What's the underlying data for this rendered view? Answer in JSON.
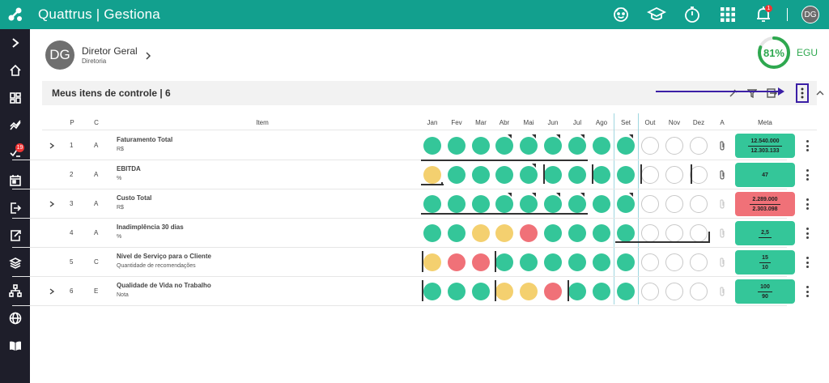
{
  "app": {
    "brand": "Quattrus",
    "product": "Gestiona",
    "title_sep": "|"
  },
  "topbar": {
    "icons": [
      "smile-icon",
      "graduation-cap-icon",
      "stopwatch-icon",
      "grid-icon",
      "bell-icon"
    ],
    "notification_count": "1",
    "avatar": "DG"
  },
  "sidebar": {
    "items": [
      {
        "icon": "chevron-right-icon"
      },
      {
        "icon": "home-icon"
      },
      {
        "icon": "dashboard-icon"
      },
      {
        "icon": "trend-icon"
      },
      {
        "icon": "check-list-icon",
        "badge": "19"
      },
      {
        "icon": "calendar-icon"
      },
      {
        "icon": "logout-icon"
      },
      {
        "icon": "export-icon"
      },
      {
        "icon": "layers-icon"
      },
      {
        "icon": "org-chart-icon"
      },
      {
        "icon": "globe-icon"
      },
      {
        "icon": "book-icon"
      }
    ]
  },
  "user": {
    "initials": "DG",
    "name": "Diretor Geral",
    "role": "Diretoria"
  },
  "egu": {
    "value": "81%",
    "percent": 81,
    "label": "EGU",
    "color": "#2ea84f"
  },
  "section": {
    "title": "Meus itens de controle | 6"
  },
  "columns": {
    "p": "P",
    "c": "C",
    "item": "Item",
    "a": "A",
    "meta": "Meta",
    "months": [
      "Jan",
      "Fev",
      "Mar",
      "Abr",
      "Mai",
      "Jun",
      "Jul",
      "Ago",
      "Set",
      "Out",
      "Nov",
      "Dez"
    ]
  },
  "colors": {
    "green": "#34c699",
    "yellow": "#f4d06f",
    "red": "#f07178",
    "accent": "#12a08e",
    "highlight": "#3b1fa6"
  },
  "rows": [
    {
      "p": "1",
      "c": "A",
      "name": "Faturamento Total",
      "unit": "R$",
      "expandable": true,
      "status": [
        "green",
        "green",
        "green",
        "green",
        "green",
        "green",
        "green",
        "green",
        "green",
        "empty",
        "empty",
        "empty"
      ],
      "meta": {
        "color": "g",
        "line1": "12.540.000",
        "line2": "12.303.133"
      }
    },
    {
      "p": "2",
      "c": "A",
      "name": "EBITDA",
      "unit": "%",
      "expandable": false,
      "status": [
        "yellow",
        "green",
        "green",
        "green",
        "green",
        "green",
        "green",
        "green",
        "green",
        "empty",
        "empty",
        "empty"
      ],
      "meta": {
        "color": "g",
        "line1": "",
        "line2": "47"
      }
    },
    {
      "p": "3",
      "c": "A",
      "name": "Custo Total",
      "unit": "R$",
      "expandable": true,
      "status": [
        "green",
        "green",
        "green",
        "green",
        "green",
        "green",
        "green",
        "green",
        "green",
        "empty",
        "empty",
        "empty"
      ],
      "meta": {
        "color": "r",
        "line1": "2.289.000",
        "line2": "2.303.098"
      }
    },
    {
      "p": "4",
      "c": "A",
      "name": "Inadimplência 30 dias",
      "unit": "%",
      "expandable": false,
      "status": [
        "green",
        "green",
        "yellow",
        "yellow",
        "red",
        "green",
        "green",
        "green",
        "green",
        "empty",
        "empty",
        "empty"
      ],
      "meta": {
        "color": "g",
        "line1": "2,5",
        "line2": ""
      }
    },
    {
      "p": "5",
      "c": "C",
      "name": "Nível de Serviço para o Cliente",
      "unit": "Quantidade de recomendações",
      "expandable": false,
      "status": [
        "yellow",
        "red",
        "red",
        "green",
        "green",
        "green",
        "green",
        "green",
        "green",
        "empty",
        "empty",
        "empty"
      ],
      "meta": {
        "color": "g",
        "line1": "15",
        "line2": "10"
      }
    },
    {
      "p": "6",
      "c": "E",
      "name": "Qualidade de Vida no Trabalho",
      "unit": "Nota",
      "expandable": true,
      "status": [
        "green",
        "green",
        "green",
        "yellow",
        "yellow",
        "red",
        "green",
        "green",
        "green",
        "empty",
        "empty",
        "empty"
      ],
      "meta": {
        "color": "g",
        "line1": "100",
        "line2": "90"
      }
    }
  ]
}
